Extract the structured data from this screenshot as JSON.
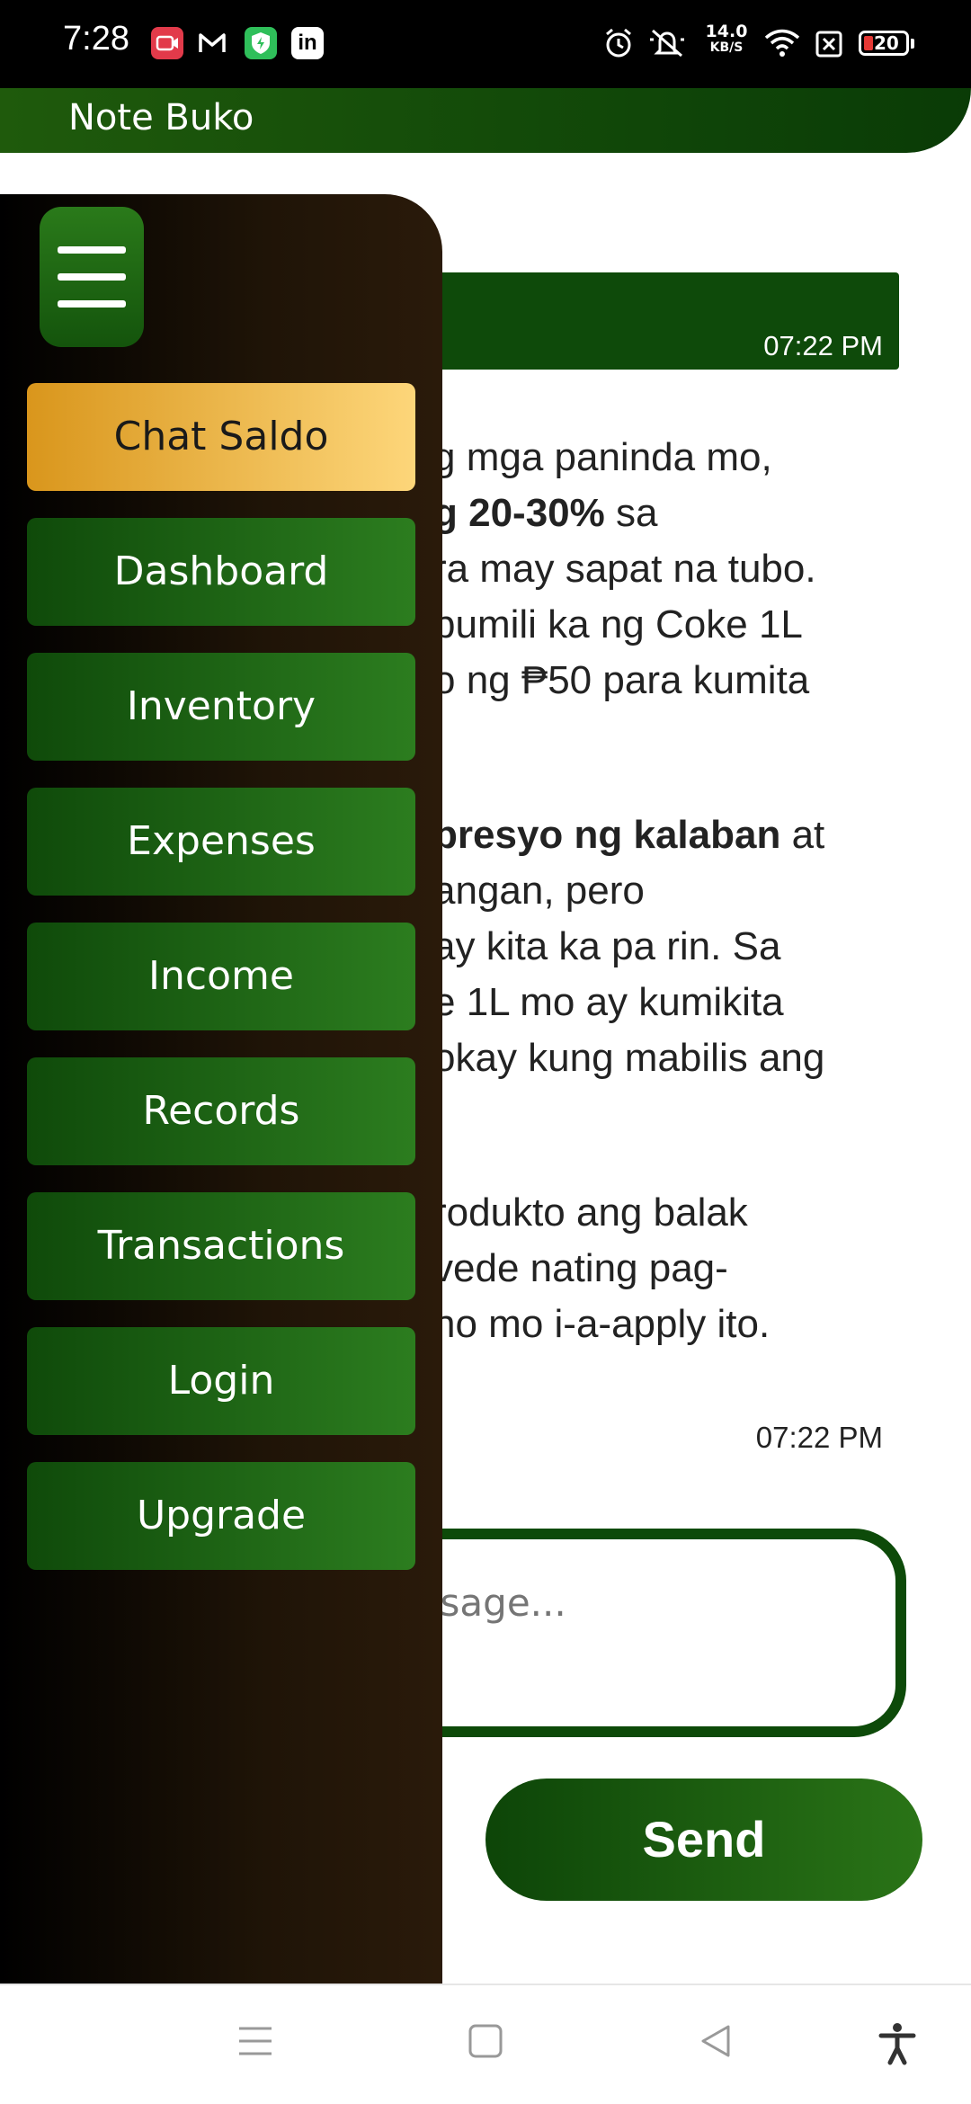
{
  "status_bar": {
    "time": "7:28",
    "net_speed_value": "14.0",
    "net_speed_unit": "KB/S",
    "battery": "20",
    "icons": [
      "screen-record-icon",
      "gmail-icon",
      "vpn-shield-icon",
      "linkedin-icon",
      "alarm-icon",
      "mute-icon",
      "wifi-icon",
      "sim-x-icon",
      "battery-icon"
    ]
  },
  "app_bar": {
    "title": "Note Buko"
  },
  "chat": {
    "user_message_time": "07:22 PM",
    "reply_lines": [
      [
        {
          "t": "g mga paninda mo,"
        }
      ],
      [
        {
          "t": "g 20-30%",
          "b": true
        },
        {
          "t": " sa"
        }
      ],
      [
        {
          "t": "ra may sapat na tubo."
        }
      ],
      [
        {
          "t": " bumili ka ng Coke 1L"
        }
      ],
      [
        {
          "t": "o ng ₱50 para kumita"
        }
      ],
      [
        {
          "t": ""
        }
      ],
      [
        {
          "t": " presyo ng kalaban",
          "b": true
        },
        {
          "t": " at"
        }
      ],
      [
        {
          "t": "angan, pero"
        }
      ],
      [
        {
          "t": "ay kita ka pa rin. Sa"
        }
      ],
      [
        {
          "t": "e 1L mo ay kumikita"
        }
      ],
      [
        {
          "t": "okay kung mabilis ang"
        }
      ],
      [
        {
          "t": ""
        }
      ],
      [
        {
          "t": "rodukto ang balak"
        }
      ],
      [
        {
          "t": "vede nating pag-"
        }
      ],
      [
        {
          "t": "no mo i-a-apply ito."
        }
      ]
    ],
    "reply_time": "07:22 PM",
    "input_placeholder": "Type a message...",
    "send_label": "Send"
  },
  "drawer": {
    "items": [
      {
        "label": "Chat Saldo",
        "active": true
      },
      {
        "label": "Dashboard"
      },
      {
        "label": "Inventory"
      },
      {
        "label": "Expenses"
      },
      {
        "label": "Income"
      },
      {
        "label": "Records"
      },
      {
        "label": "Transactions"
      },
      {
        "label": "Login"
      },
      {
        "label": "Upgrade"
      }
    ]
  },
  "colors": {
    "brand_green": "#0e4a0a",
    "active_gold": "#f5c65c",
    "drawer_bg": "#1f1407"
  }
}
